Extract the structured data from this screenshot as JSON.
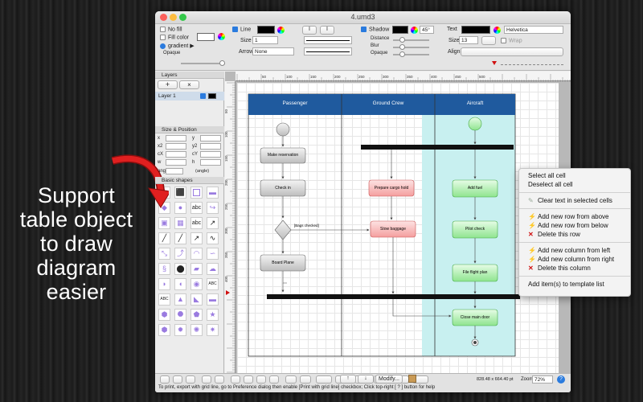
{
  "promo": {
    "lines": [
      "Support",
      "table object",
      "to draw",
      "diagram",
      "easier"
    ]
  },
  "window": {
    "title": "4.umd3"
  },
  "toolbar": {
    "no_fill": "No fill",
    "fill_color": "Fill color",
    "gradient": "gradient ▶",
    "opaque": "Opaque",
    "line": "Line",
    "size_label": "Size",
    "size_value": "1",
    "arrow_label": "Arrow",
    "arrow_value": "None",
    "shadow": "Shadow",
    "shadow_angle": "45°",
    "distance": "Distance",
    "blur": "Blur",
    "shadow_opaque": "Opaque",
    "text_label": "Text",
    "font": "Helvetica",
    "text_size_label": "Size",
    "text_size": "13",
    "wrap": "Wrap",
    "align_label": "Align"
  },
  "left_panel": {
    "layers_header": "Layers",
    "layer_name": "Layer 1",
    "size_position_header": "Size & Position",
    "fields": [
      "x",
      "y",
      "x2",
      "y2",
      "cX",
      "cY",
      "w",
      "h",
      "ang"
    ],
    "angle_suffix": "(angle)",
    "basic_shapes_header": "Basic shapes",
    "shape_text": "abc",
    "shape_text2": "ABC"
  },
  "diagram": {
    "lanes": [
      "Passenger",
      "Ground Crew",
      "Aircraft"
    ],
    "nodes": {
      "make_reservation": "Make reservation",
      "check_in": "Check in",
      "bags_checked": "[Bags checked]",
      "board_plane": "Board Plane",
      "prepare_cargo": "Prepare cargo hold",
      "stow_baggage": "Stow baggage",
      "add_fuel": "Add fuel",
      "pilot_check": "Pilot check",
      "file_flight_plan": "File flight plan",
      "close_main_door": "Close main door"
    }
  },
  "ruler": {
    "labels": [
      "50",
      "100",
      "150",
      "200",
      "250",
      "300",
      "350",
      "400",
      "450",
      "500"
    ],
    "vlabels": [
      "50",
      "100",
      "150",
      "200",
      "250",
      "300",
      "350",
      "400"
    ]
  },
  "status": {
    "modify": "Modify...",
    "coords": "828.48 x 664.40 pt",
    "zoom_label": "Zoom",
    "zoom_value": "72%",
    "hint": "To print, export with grid line, go to Preference dialog then enable [Print with grid line] checkbox; Click top-right [ ? ] button for help"
  },
  "context_menu": {
    "select_all": "Select all cell",
    "deselect_all": "Deselect all cell",
    "clear_text": "Clear text in selected cells",
    "add_row_above": "Add new row from above",
    "add_row_below": "Add new row from below",
    "delete_row": "Delete this row",
    "add_col_left": "Add new column from left",
    "add_col_right": "Add new column from right",
    "delete_col": "Delete this column",
    "add_template": "Add item(s) to template list"
  },
  "colors": {
    "header_blue": "#1f5a9e",
    "lane_cyan": "#c8f0f0",
    "gray_node": "#d4d4d4",
    "red_node": "#f7c3c3",
    "green_node": "#c4f2c4",
    "arrow_red": "#c81414"
  }
}
